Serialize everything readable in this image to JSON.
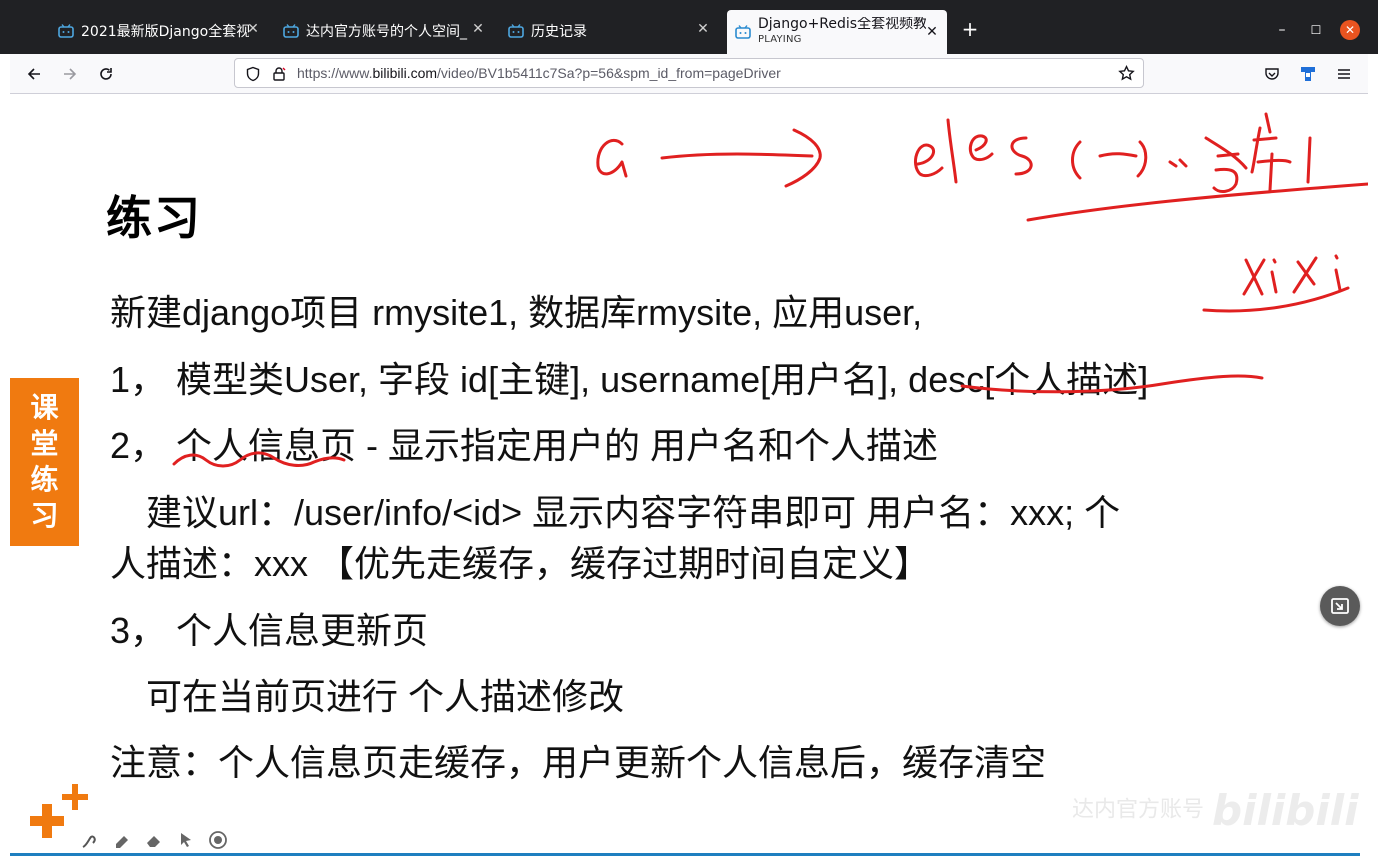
{
  "browser": {
    "tabs": [
      {
        "title": "2021最新版Django全套视",
        "active": false
      },
      {
        "title": "达内官方账号的个人空间_",
        "active": false
      },
      {
        "title": "历史记录",
        "active": false
      },
      {
        "title": "Django+Redis全套视频教",
        "subtitle": "PLAYING",
        "active": true
      }
    ],
    "url_prefix": "https://www.",
    "url_host": "bilibili.com",
    "url_path": "/video/BV1b5411c7Sa?p=56&spm_id_from=pageDriver",
    "accent_color": "#e95420"
  },
  "slide": {
    "heading": "练习",
    "side_badge": [
      "课",
      "堂",
      "练",
      "习"
    ],
    "lines": [
      "新建django项目 rmysite1, 数据库rmysite, 应用user,",
      "1，  模型类User, 字段 id[主键], username[用户名],  desc[个人描述]",
      "2，  个人信息页 - 显示指定用户的 用户名和个人描述",
      "建议url：/user/info/<id>     显示内容字符串即可   用户名：xxx; 个",
      "人描述：xxx   【优先走缓存，缓存过期时间自定义】",
      "3，  个人信息更新页",
      "可在当前页进行 个人描述修改",
      "注意：个人信息页走缓存，用户更新个人信息后，缓存清空"
    ],
    "watermark_text": "达内官方账号",
    "watermark_logo": "bilibili",
    "badge_color": "#f07a10",
    "ink_color": "#e02020"
  }
}
